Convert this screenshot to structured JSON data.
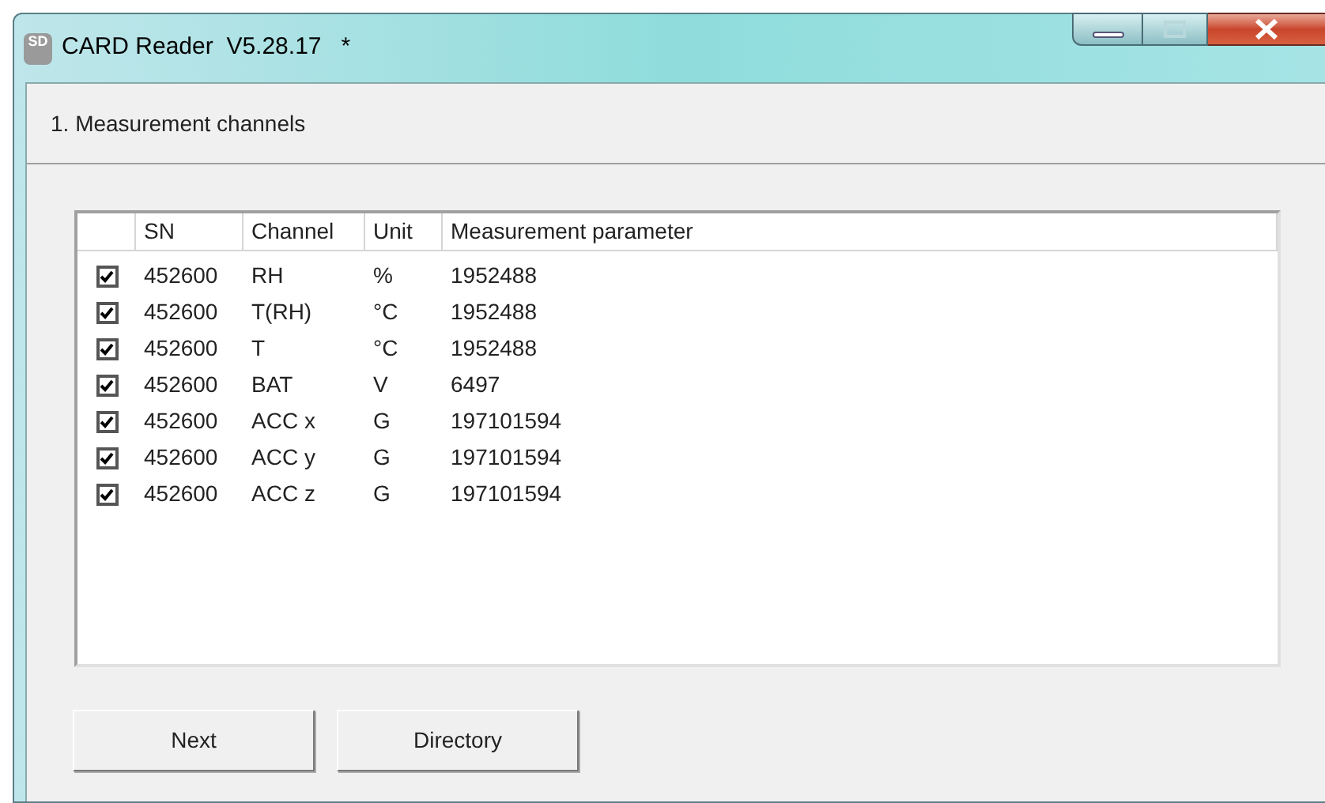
{
  "window": {
    "title": "CARD Reader  V5.28.17   *",
    "icon_text": "SD"
  },
  "section": {
    "title": "1. Measurement channels"
  },
  "table": {
    "columns": [
      "SN",
      "Channel",
      "Unit",
      "Measurement parameter"
    ],
    "rows": [
      {
        "checked": true,
        "cells": [
          "452600",
          "RH",
          "%",
          "1952488"
        ]
      },
      {
        "checked": true,
        "cells": [
          "452600",
          "T(RH)",
          "°C",
          "1952488"
        ]
      },
      {
        "checked": true,
        "cells": [
          "452600",
          "T",
          "°C",
          "1952488"
        ]
      },
      {
        "checked": true,
        "cells": [
          "452600",
          "BAT",
          "V",
          "6497"
        ]
      },
      {
        "checked": true,
        "cells": [
          "452600",
          "ACC x",
          "G",
          "197101594"
        ]
      },
      {
        "checked": true,
        "cells": [
          "452600",
          "ACC y",
          "G",
          "197101594"
        ]
      },
      {
        "checked": true,
        "cells": [
          "452600",
          "ACC z",
          "G",
          "197101594"
        ]
      }
    ]
  },
  "buttons": [
    "Next",
    "Directory"
  ]
}
